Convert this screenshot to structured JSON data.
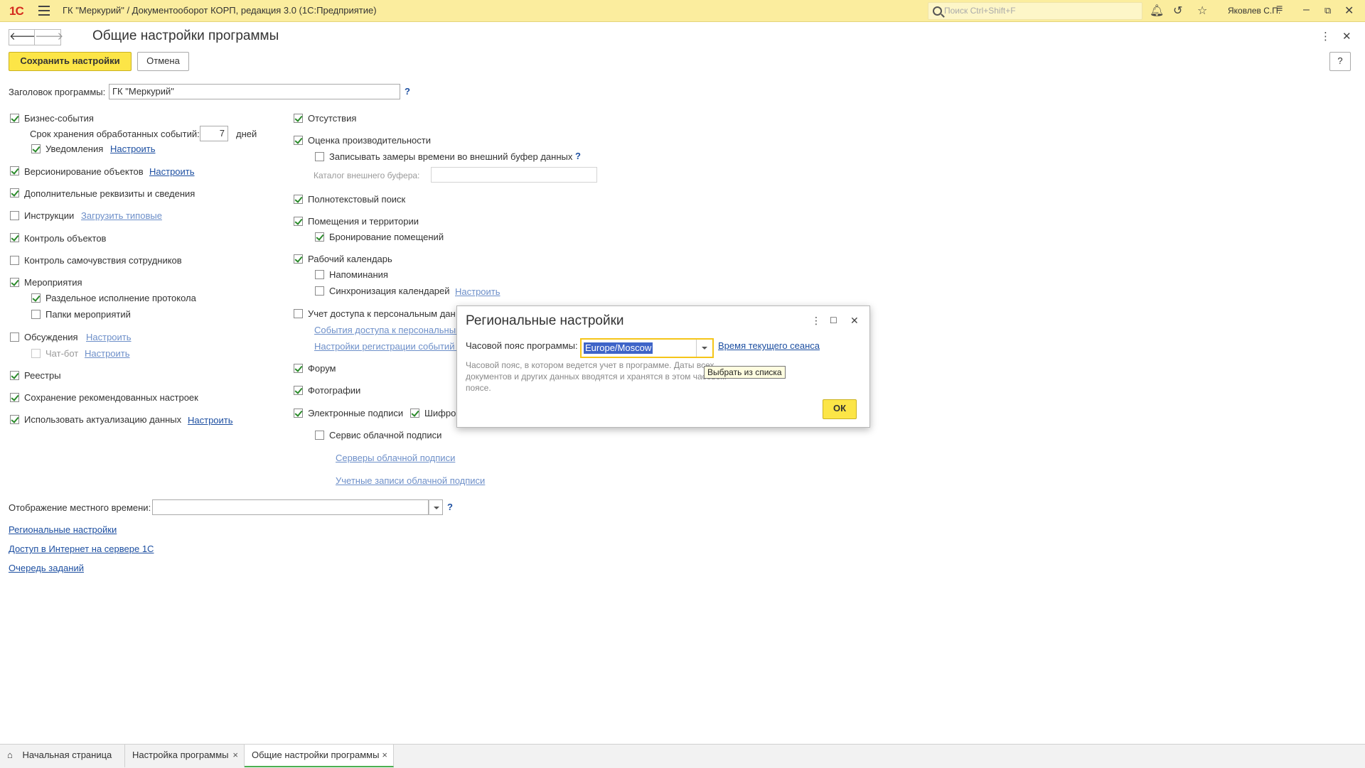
{
  "app": {
    "logo": "1С",
    "title": "ГК \"Меркурий\" / Документооборот КОРП, редакция 3.0  (1С:Предприятие)",
    "search_placeholder": "Поиск Ctrl+Shift+F",
    "user": "Яковлев С.П."
  },
  "header": {
    "back": "🡐",
    "forward": "🡒",
    "title": "Общие настройки программы",
    "save": "Сохранить настройки",
    "cancel": "Отмена",
    "help": "?"
  },
  "program_title": {
    "label": "Заголовок программы:",
    "value": "ГК \"Меркурий\"",
    "help": "?"
  },
  "left": {
    "business_events": "Бизнес-события",
    "retention_label": "Срок хранения обработанных событий:",
    "retention_value": "7",
    "retention_unit": "дней",
    "notifications": "Уведомления",
    "notifications_link": "Настроить",
    "versioning": "Версионирование объектов",
    "versioning_link": "Настроить",
    "extra_attrs": "Дополнительные реквизиты и сведения",
    "instructions": "Инструкции",
    "instructions_link": "Загрузить типовые",
    "objects_control": "Контроль объектов",
    "wellbeing": "Контроль самочувствия сотрудников",
    "events": "Мероприятия",
    "separate_protocol": "Раздельное исполнение протокола",
    "event_folders": "Папки мероприятий",
    "discussions": "Обсуждения",
    "discussions_link": "Настроить",
    "chatbot": "Чат-бот",
    "chatbot_link": "Настроить",
    "registries": "Реестры",
    "recommended": "Сохранение рекомендованных настроек",
    "actualization": "Использовать актуализацию данных",
    "actualization_link": "Настроить"
  },
  "right": {
    "absences": "Отсутствия",
    "performance": "Оценка производительности",
    "write_measurements": "Записывать замеры времени во внешний буфер данных",
    "buffer_label": "Каталог внешнего буфера:",
    "fulltext": "Полнотекстовый поиск",
    "premises": "Помещения и территории",
    "room_booking": "Бронирование помещений",
    "work_calendar": "Рабочий календарь",
    "reminders": "Напоминания",
    "calendar_sync": "Синхронизация календарей",
    "calendar_sync_link": "Настроить",
    "personal_access": "Учет доступа к персональным дан",
    "personal_access_events": "События доступа к персональным",
    "personal_access_reg": "Настройки регистрации событий д",
    "forum": "Форум",
    "photos": "Фотографии",
    "e_signatures": "Электронные подписи",
    "encryption": "Шифров",
    "cloud_service": "Сервис облачной подписи",
    "cloud_servers": "Серверы облачной подписи",
    "cloud_accounts": "Учетные записи облачной подписи"
  },
  "bottom": {
    "local_time_label": "Отображение местного времени:",
    "local_time_value": "",
    "help": "?",
    "link_regional": "Региональные настройки",
    "link_internet": "Доступ в Интернет на сервере 1С",
    "link_queue": "Очередь заданий"
  },
  "dialog": {
    "title": "Региональные настройки",
    "tz_label": "Часовой пояс программы:",
    "tz_value": "Europe/Moscow",
    "session_link": "Время текущего сеанса",
    "hint": "Часовой пояс, в котором ведется учет в программе. Даты всех документов и других данных вводятся и хранятся в этом часовом поясе.",
    "tooltip": "Выбрать из списка",
    "ok": "ОК"
  },
  "tabs": [
    {
      "label": "Начальная страница"
    },
    {
      "label": "Настройка программы",
      "close": "×"
    },
    {
      "label": "Общие настройки программы",
      "close": "×"
    }
  ],
  "colors": {
    "topbar": "#fbed9e",
    "primary_button": "#fce547",
    "link": "#1d4fa1",
    "check": "#2a8a2a"
  }
}
